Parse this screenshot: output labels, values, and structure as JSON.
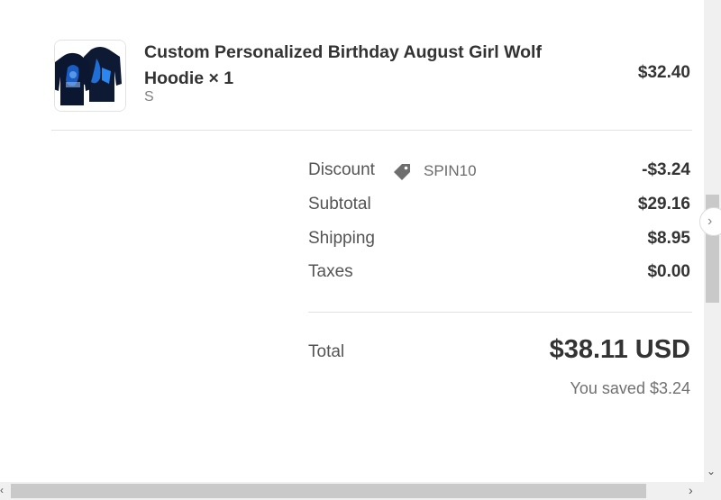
{
  "product": {
    "title": "Custom Personalized Birthday August Girl Wolf Hoodie × 1",
    "variant": "S",
    "price": "$32.40",
    "image_icon": "hoodie-image"
  },
  "summary": {
    "discount": {
      "label": "Discount",
      "icon": "tag-icon",
      "code": "SPIN10",
      "amount": "-$3.24"
    },
    "subtotal": {
      "label": "Subtotal",
      "amount": "$29.16"
    },
    "shipping": {
      "label": "Shipping",
      "amount": "$8.95"
    },
    "taxes": {
      "label": "Taxes",
      "amount": "$0.00"
    }
  },
  "total": {
    "label": "Total",
    "amount": "$38.11 USD",
    "saved": "You saved $3.24"
  },
  "scrollbars": {
    "right_arrow": "›",
    "down_arrow": "⌄",
    "left_arrow": "‹",
    "next_arrow": "›"
  }
}
